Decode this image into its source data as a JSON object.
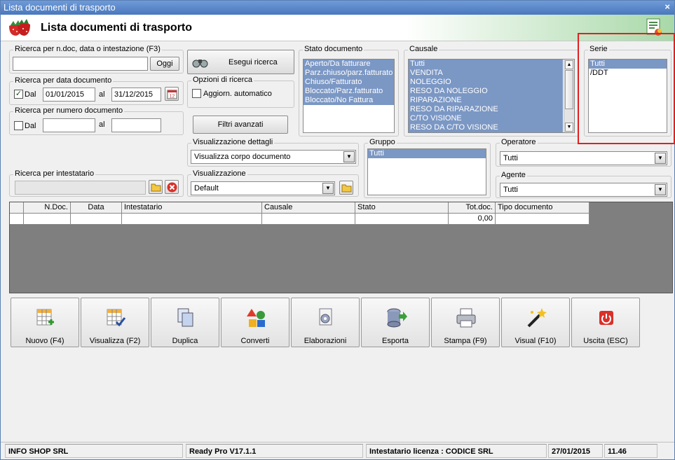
{
  "window": {
    "title": "Lista documenti di trasporto",
    "close": "×",
    "heading": "Lista documenti di trasporto"
  },
  "search_text": {
    "label": "Ricerca per n.doc, data o intestazione (F3)",
    "value": "",
    "button": "Oggi"
  },
  "search_button": "Esegui ricerca",
  "search_date": {
    "label": "Ricerca per data documento",
    "dal_label": "Dal",
    "dal_checked": true,
    "from": "01/01/2015",
    "al_label": "al",
    "to": "31/12/2015"
  },
  "search_options": {
    "label": "Opzioni di ricerca",
    "auto_update": "Aggiorn. automatico",
    "auto_checked": false
  },
  "search_number": {
    "label": "Ricerca per numero documento",
    "dal_label": "Dal",
    "dal_checked": false,
    "from": "",
    "al_label": "al",
    "to": ""
  },
  "advanced_filters": "Filtri avanzati",
  "stato": {
    "label": "Stato documento",
    "items": [
      "Aperto/Da fatturare",
      "Parz.chiuso/parz.fatturato",
      "Chiuso/Fatturato",
      "Bloccato/Parz.fatturato",
      "Bloccato/No Fattura"
    ]
  },
  "causale": {
    "label": "Causale",
    "items": [
      "Tutti",
      "VENDITA",
      "NOLEGGIO",
      "RESO DA NOLEGGIO",
      "RIPARAZIONE",
      "RESO DA RIPARAZIONE",
      "C/TO VISIONE",
      "RESO DA C/TO VISIONE"
    ]
  },
  "serie": {
    "label": "Serie",
    "items": [
      "Tutti",
      "/DDT"
    ]
  },
  "vis_dettagli": {
    "label": "Visualizzazione dettagli",
    "value": "Visualizza corpo documento"
  },
  "gruppo": {
    "label": "Gruppo",
    "items": [
      "Tutti"
    ]
  },
  "operatore": {
    "label": "Operatore",
    "value": "Tutti"
  },
  "intestatario": {
    "label": "Ricerca per intestatario",
    "value": ""
  },
  "visualizzazione": {
    "label": "Visualizzazione",
    "value": "Default"
  },
  "agente": {
    "label": "Agente",
    "value": "Tutti"
  },
  "table": {
    "columns": [
      "",
      "N.Doc.",
      "Data",
      "Intestatario",
      "Causale",
      "Stato",
      "Tot.doc.",
      "Tipo documento"
    ],
    "rows": [
      [
        "",
        "",
        "",
        "",
        "",
        "",
        "0,00",
        ""
      ]
    ]
  },
  "actions": [
    {
      "label": "Nuovo (F4)",
      "icon": "grid-add-icon"
    },
    {
      "label": "Visualizza (F2)",
      "icon": "grid-check-icon"
    },
    {
      "label": "Duplica",
      "icon": "copy-pages-icon"
    },
    {
      "label": "Converti",
      "icon": "convert-shapes-icon"
    },
    {
      "label": "Elaborazioni",
      "icon": "gear-document-icon"
    },
    {
      "label": "Esporta",
      "icon": "database-export-icon"
    },
    {
      "label": "Stampa (F9)",
      "icon": "printer-icon"
    },
    {
      "label": "Visual (F10)",
      "icon": "magic-wand-icon"
    },
    {
      "label": "Uscita (ESC)",
      "icon": "power-icon"
    }
  ],
  "status": {
    "company": "INFO SHOP SRL",
    "version": "Ready Pro V17.1.1",
    "license": "Intestatario licenza : CODICE SRL",
    "date": "27/01/2015",
    "time": "11.46"
  },
  "colors": {
    "accent": "#7b97c4",
    "highlight": "#e02020",
    "titlebar": "#4a78bd"
  }
}
